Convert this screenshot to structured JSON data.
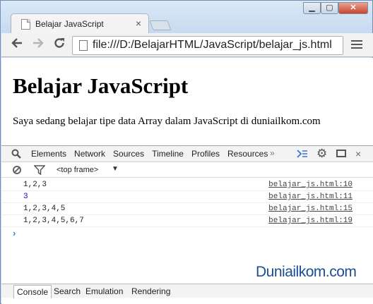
{
  "browser": {
    "tab_title": "Belajar JavaScript",
    "tab_close": "×",
    "window_controls": {
      "minimize": "▁",
      "maximize": "▢",
      "close": "✕"
    },
    "url": "file:///D:/BelajarHTML/JavaScript/belajar_js.html"
  },
  "page": {
    "heading": "Belajar JavaScript",
    "paragraph": "Saya sedang belajar tipe data Array dalam JavaScript di duniailkom.com"
  },
  "devtools": {
    "tabs": [
      "Elements",
      "Network",
      "Sources",
      "Timeline",
      "Profiles",
      "Resources"
    ],
    "more": "»",
    "close": "×",
    "frame_selector": "<top frame>",
    "console_rows": [
      {
        "message": "1,2,3",
        "source": "belajar_js.html:10",
        "is_number": false
      },
      {
        "message": "3",
        "source": "belajar_js.html:11",
        "is_number": true
      },
      {
        "message": "1,2,3,4,5",
        "source": "belajar_js.html:15",
        "is_number": false
      },
      {
        "message": "1,2,3,4,5,6,7",
        "source": "belajar_js.html:19",
        "is_number": false
      }
    ],
    "prompt": "›",
    "drawer_tabs": [
      "Console",
      "Search",
      "Emulation",
      "Rendering"
    ],
    "active_drawer_tab": "Console"
  },
  "watermark": {
    "part1": "Dunia",
    "part2": "ilkom.com"
  }
}
